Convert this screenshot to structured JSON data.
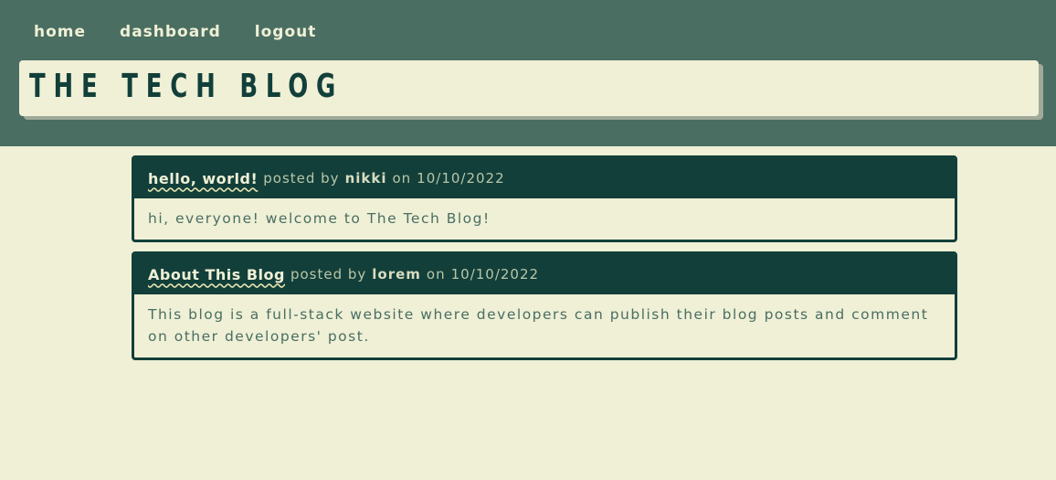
{
  "nav": {
    "home": "home",
    "dashboard": "dashboard",
    "logout": "logout"
  },
  "site_title": "THE TECH BLOG",
  "posts": [
    {
      "title": "hello, world!",
      "posted_by": "posted by",
      "author": "nikki",
      "on": "on",
      "date": "10/10/2022",
      "body": "hi, everyone! welcome to The Tech Blog!"
    },
    {
      "title": "About This Blog",
      "posted_by": "posted by",
      "author": "lorem",
      "on": "on",
      "date": "10/10/2022",
      "body": "This blog is a full-stack website where developers can publish their blog posts and comment on other developers' post."
    }
  ],
  "colors": {
    "header_bg": "#4a6e62",
    "page_bg": "#eff0d6",
    "dark_green": "#123f3a"
  }
}
